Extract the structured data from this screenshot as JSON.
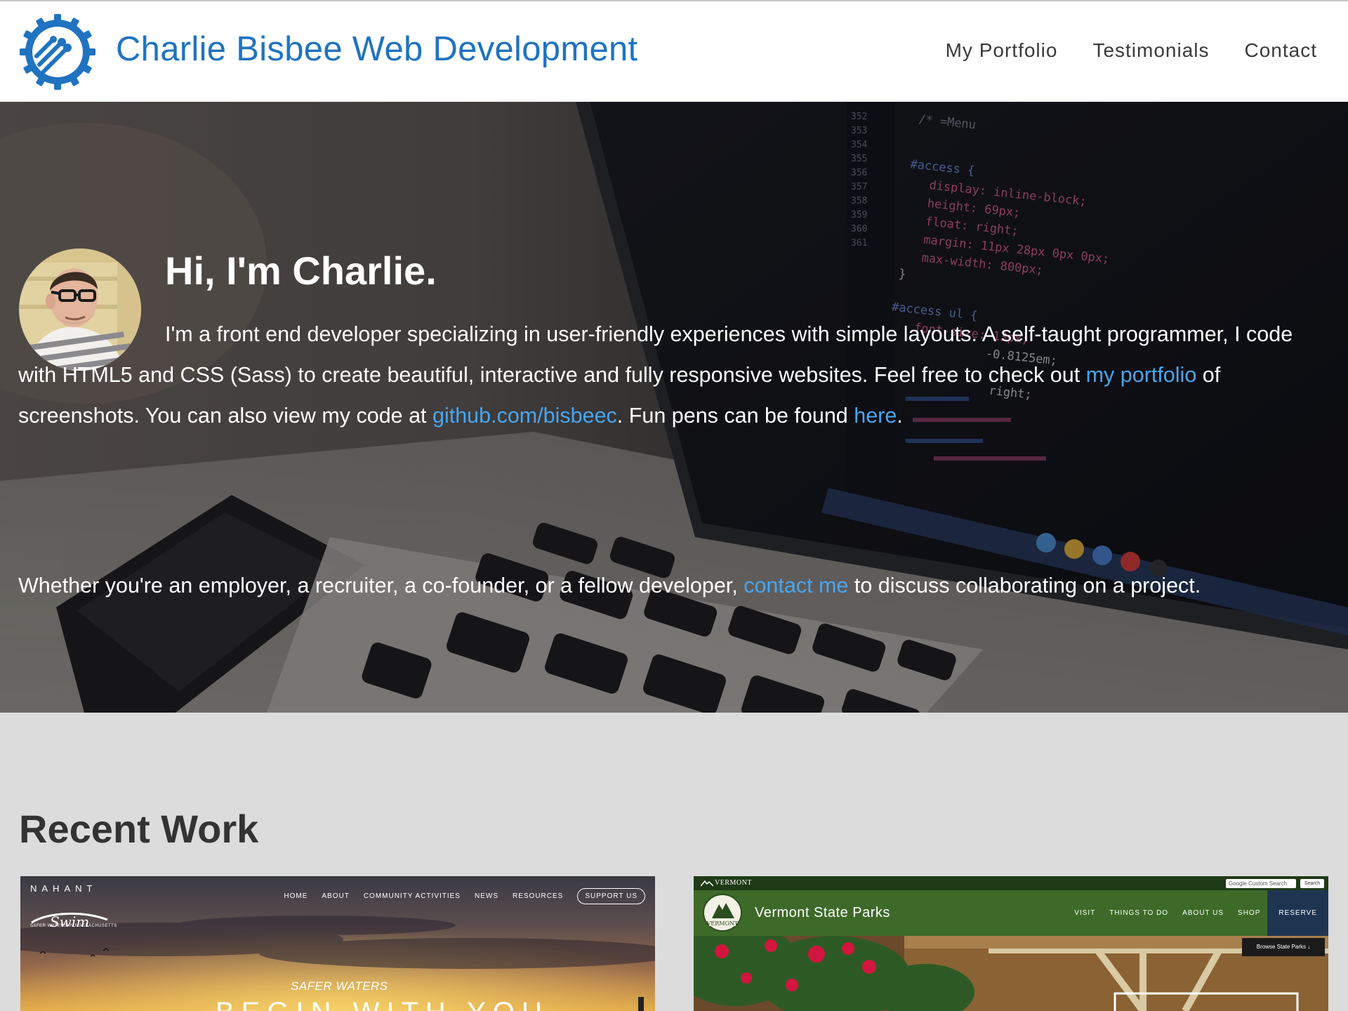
{
  "header": {
    "site_title": "Charlie Bisbee Web Development",
    "logo_icon": "gear-circuit-logo-icon",
    "nav": [
      {
        "label": "My Portfolio"
      },
      {
        "label": "Testimonials"
      },
      {
        "label": "Contact"
      }
    ],
    "brand_color": "#1f73c1"
  },
  "hero": {
    "heading": "Hi, I'm Charlie.",
    "intro_text_1": "I'm a front end developer specializing in user-friendly experiences with simple layouts. A self-taught programmer, I code with HTML5 and CSS (Sass) to create beautiful, interactive and fully responsive websites. Feel free to check out ",
    "portfolio_link": "my portfolio",
    "intro_text_2": " of screenshots. You can also view my code at ",
    "github_link": "github.com/bisbeec",
    "intro_text_3": ". Fun pens can be found ",
    "pens_link": "here",
    "intro_text_4": ".",
    "contact_text_1": "Whether you're an employer, a recruiter, a co-founder, or a fellow developer, ",
    "contact_link": "contact me",
    "contact_text_2": " to discuss collaborating on a project.",
    "link_color": "#4aa5f0",
    "code_snippet": [
      "/* =Menu",
      "#access {",
      "display: inline-block;",
      "height: 69px;",
      "float: right;",
      "margin: 11px 28px 0px 0px;",
      "max-width: 800px;",
      "}",
      "#access ul {",
      "font-size: 13px;",
      "-0.8125em;",
      "right;"
    ],
    "line_numbers": [
      "352",
      "353",
      "354",
      "355",
      "356",
      "357",
      "358",
      "359",
      "360",
      "361"
    ]
  },
  "recent_work": {
    "heading": "Recent Work",
    "nahant": {
      "brand": "NAHANT",
      "logo_text": "Swim",
      "tagline": "SAFER WATERS IN MASSACHUSETTS",
      "nav": [
        "HOME",
        "ABOUT",
        "COMMUNITY ACTIVITIES",
        "NEWS",
        "RESOURCES"
      ],
      "support_button": "SUPPORT US",
      "subheading": "SAFER WATERS",
      "headline": "BEGIN WITH YOU"
    },
    "vermont": {
      "top_label": "VERMONT",
      "search_placeholder": "Google  Custom Search",
      "search_button": "Search",
      "title": "Vermont State Parks",
      "emblem_text": "VERMONT",
      "nav": [
        "VISIT",
        "THINGS TO DO",
        "ABOUT US",
        "SHOP"
      ],
      "reserve": "RESERVE",
      "browse": "Browse State Parks"
    }
  }
}
